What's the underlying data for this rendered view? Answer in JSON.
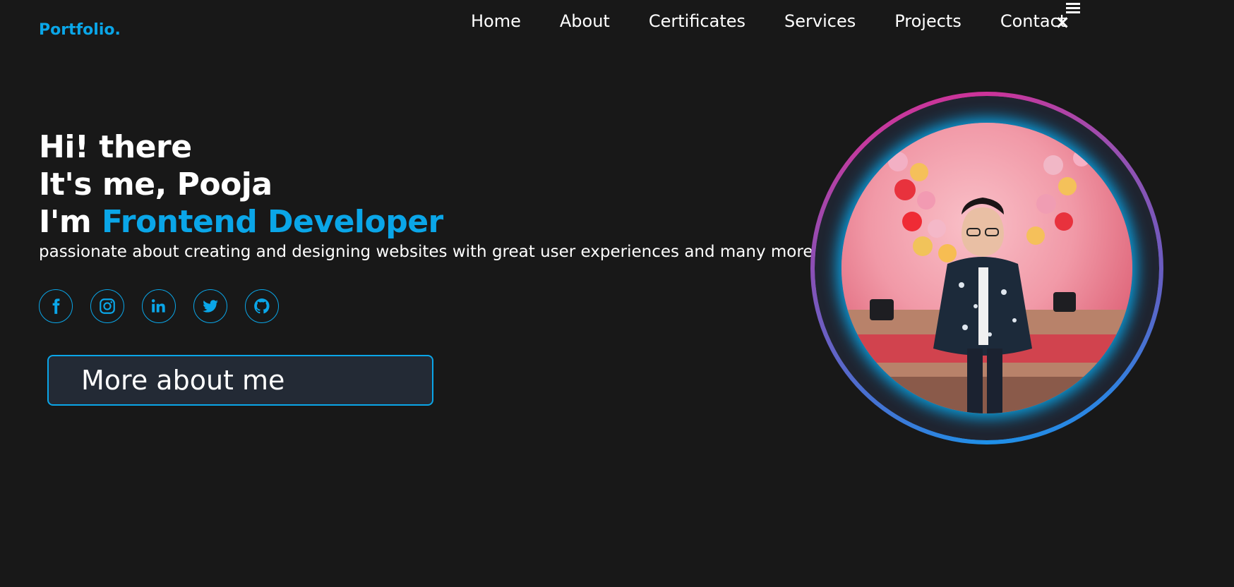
{
  "header": {
    "logo": "Portfolio.",
    "nav": [
      "Home",
      "About",
      "Certificates",
      "Services",
      "Projects",
      "Contact"
    ],
    "close_glyph": "×",
    "menu_icon": "hamburger-icon"
  },
  "hero": {
    "line1": "Hi! there",
    "line2": "It's me, Pooja",
    "line3_prefix": "I'm ",
    "line3_accent": "Frontend Developer",
    "tagline": "passionate about creating and designing websites with great user experiences and many more...",
    "button_label": "More about me"
  },
  "socials": [
    {
      "icon": "facebook-icon"
    },
    {
      "icon": "instagram-icon"
    },
    {
      "icon": "linkedin-icon"
    },
    {
      "icon": "twitter-icon"
    },
    {
      "icon": "github-icon"
    }
  ],
  "colors": {
    "background": "#181818",
    "accent": "#0aa6e8",
    "button_bg": "#232a35"
  }
}
